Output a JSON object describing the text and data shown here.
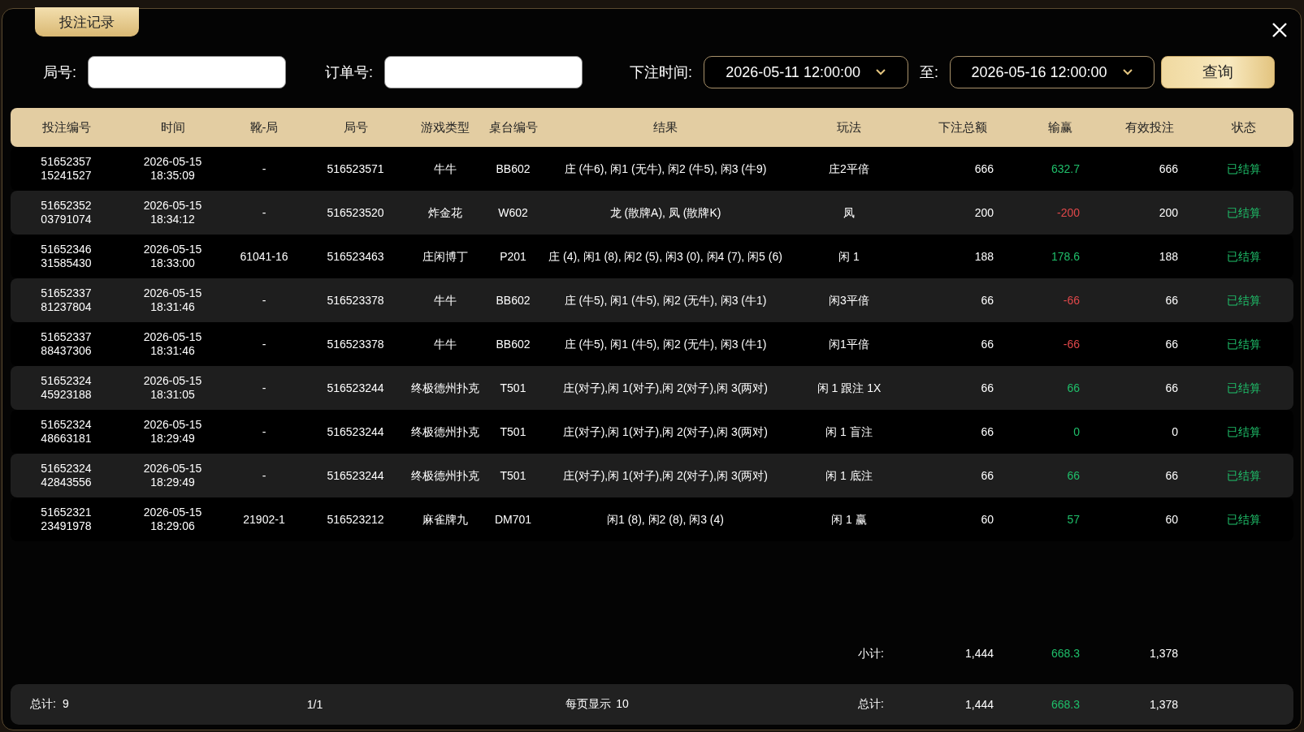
{
  "dialog": {
    "tab": {
      "label": "投注记录",
      "selected": true
    }
  },
  "filters": {
    "round_label": "局号:",
    "order_label": "订单号:",
    "time_label": "下注时间:",
    "start": "2026-05-11 12:00:00",
    "to_label": "至:",
    "end": "2026-05-16 12:00:00",
    "query_button": "查询"
  },
  "table": {
    "columns": [
      "投注编号",
      "时间",
      "靴-局",
      "局号",
      "游戏类型",
      "桌台编号",
      "结果",
      "玩法",
      "下注总额",
      "输赢",
      "有效投注",
      "状态"
    ],
    "rows": [
      {
        "bet_id": "5165235715241527",
        "time": "2026-05-15 18:35:09",
        "shoe": "-",
        "round": "516523571",
        "game": "牛牛",
        "table": "BB602",
        "result": "庄 (牛6), 闲1 (无牛), 闲2 (牛5), 闲3 (牛9)",
        "bet_type": "庄2平倍",
        "amount": "666",
        "winloss": "632.7",
        "color": "#1fbf6a",
        "valid": "666",
        "status": "已结算"
      },
      {
        "bet_id": "5165235203791074",
        "time": "2026-05-15 18:34:12",
        "shoe": "-",
        "round": "516523520",
        "game": "炸金花",
        "table": "W602",
        "result": "龙 (散牌A), 凤 (散牌K)",
        "bet_type": "凤",
        "amount": "200",
        "winloss": "-200",
        "color": "#e0484a",
        "valid": "200",
        "status": "已结算"
      },
      {
        "bet_id": "5165234631585430",
        "time": "2026-05-15 18:33:00",
        "shoe": "61041-16",
        "round": "516523463",
        "game": "庄闲博丁",
        "table": "P201",
        "result": "庄 (4), 闲1 (8), 闲2 (5), 闲3 (0), 闲4 (7), 闲5 (6)",
        "bet_type": "闲 1",
        "amount": "188",
        "winloss": "178.6",
        "color": "#1fbf6a",
        "valid": "188",
        "status": "已结算"
      },
      {
        "bet_id": "5165233781237804",
        "time": "2026-05-15 18:31:46",
        "shoe": "-",
        "round": "516523378",
        "game": "牛牛",
        "table": "BB602",
        "result": "庄 (牛5), 闲1 (牛5), 闲2 (无牛), 闲3 (牛1)",
        "bet_type": "闲3平倍",
        "amount": "66",
        "winloss": "-66",
        "color": "#e0484a",
        "valid": "66",
        "status": "已结算"
      },
      {
        "bet_id": "5165233788437306",
        "time": "2026-05-15 18:31:46",
        "shoe": "-",
        "round": "516523378",
        "game": "牛牛",
        "table": "BB602",
        "result": "庄 (牛5), 闲1 (牛5), 闲2 (无牛), 闲3 (牛1)",
        "bet_type": "闲1平倍",
        "amount": "66",
        "winloss": "-66",
        "color": "#e0484a",
        "valid": "66",
        "status": "已结算"
      },
      {
        "bet_id": "5165232445923188",
        "time": "2026-05-15 18:31:05",
        "shoe": "-",
        "round": "516523244",
        "game": "终极德州扑克",
        "table": "T501",
        "result": "庄(对子),闲 1(对子),闲 2(对子),闲 3(两对)",
        "bet_type": "闲 1 跟注 1X",
        "amount": "66",
        "winloss": "66",
        "color": "#1fbf6a",
        "valid": "66",
        "status": "已结算"
      },
      {
        "bet_id": "5165232448663181",
        "time": "2026-05-15 18:29:49",
        "shoe": "-",
        "round": "516523244",
        "game": "终极德州扑克",
        "table": "T501",
        "result": "庄(对子),闲 1(对子),闲 2(对子),闲 3(两对)",
        "bet_type": "闲 1 盲注",
        "amount": "66",
        "winloss": "0",
        "color": "#1fbf6a",
        "valid": "0",
        "status": "已结算"
      },
      {
        "bet_id": "5165232442843556",
        "time": "2026-05-15 18:29:49",
        "shoe": "-",
        "round": "516523244",
        "game": "终极德州扑克",
        "table": "T501",
        "result": "庄(对子),闲 1(对子),闲 2(对子),闲 3(两对)",
        "bet_type": "闲 1 底注",
        "amount": "66",
        "winloss": "66",
        "color": "#1fbf6a",
        "valid": "66",
        "status": "已结算"
      },
      {
        "bet_id": "5165232123491978",
        "time": "2026-05-15 18:29:06",
        "shoe": "21902-1",
        "round": "516523212",
        "game": "麻雀牌九",
        "table": "DM701",
        "result": "闲1 (8), 闲2 (8), 闲3 (4)",
        "bet_type": "闲 1 赢",
        "amount": "60",
        "winloss": "57",
        "color": "#1fbf6a",
        "valid": "60",
        "status": "已结算"
      }
    ]
  },
  "subtotal": {
    "label": "小计:",
    "amount": "1,444",
    "winloss": "668.3",
    "color": "#1fbf6a",
    "valid": "1,378"
  },
  "footer": {
    "count_label": "总计:",
    "count": "9",
    "page": "1/1",
    "page_size_label": "每页显示",
    "page_size": "10",
    "total_label": "总计:",
    "amount": "1,444",
    "winloss": "668.3",
    "color": "#1fbf6a",
    "valid": "1,378"
  }
}
